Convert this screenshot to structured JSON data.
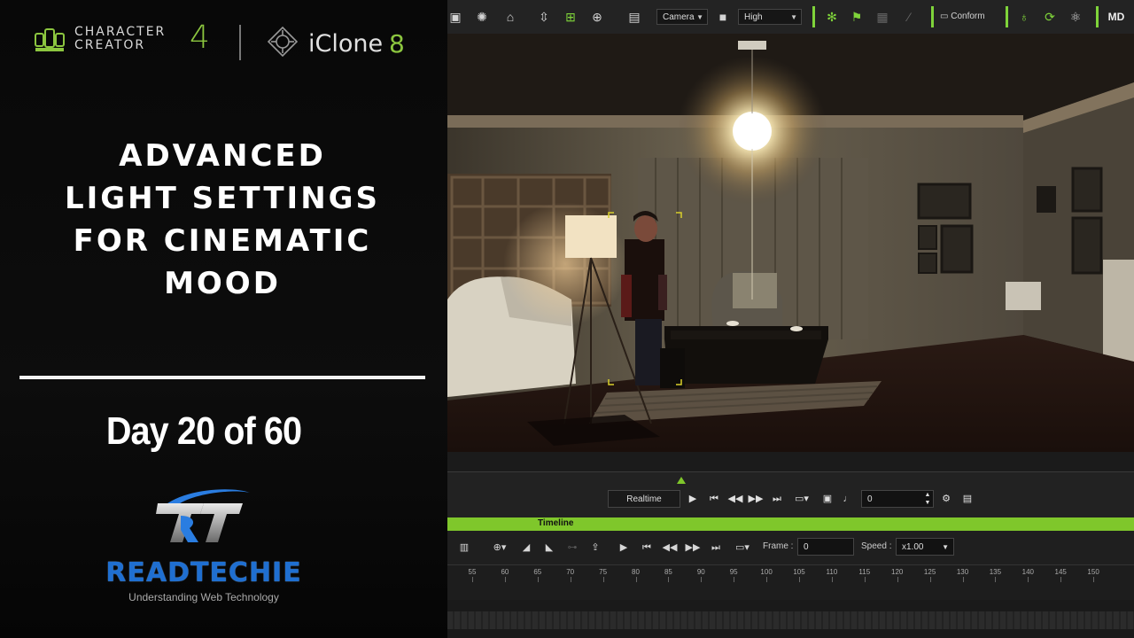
{
  "promo": {
    "brand_cc_line1": "CHARACTER",
    "brand_cc_line2": "CREATOR",
    "brand_cc_version": "4",
    "brand_ic_name": "iClone",
    "brand_ic_version": "8",
    "headline_line1": "ADVANCED",
    "headline_line2": "LIGHT SETTINGS",
    "headline_line3": "FOR CINEMATIC",
    "headline_line4": "MOOD",
    "day_label": "Day 20 of 60",
    "logo_name": "READTECHIE",
    "logo_tagline": "Understanding Web Technology"
  },
  "toolbar": {
    "camera_select": "Camera",
    "quality_select": "High",
    "conform_label": "Conform"
  },
  "playback": {
    "realtime_label": "Realtime",
    "frame_value": "0"
  },
  "timeline": {
    "title": "Timeline",
    "frame_label": "Frame :",
    "frame_value": "0",
    "speed_label": "Speed :",
    "speed_value": "x1.00",
    "ticks": [
      "55",
      "60",
      "65",
      "70",
      "75",
      "80",
      "85",
      "90",
      "95",
      "100",
      "105",
      "110",
      "115",
      "120",
      "125",
      "130",
      "135",
      "140",
      "145",
      "150"
    ]
  },
  "colors": {
    "accent_green": "#7fc72b",
    "logo_blue": "#1f6fd1"
  }
}
